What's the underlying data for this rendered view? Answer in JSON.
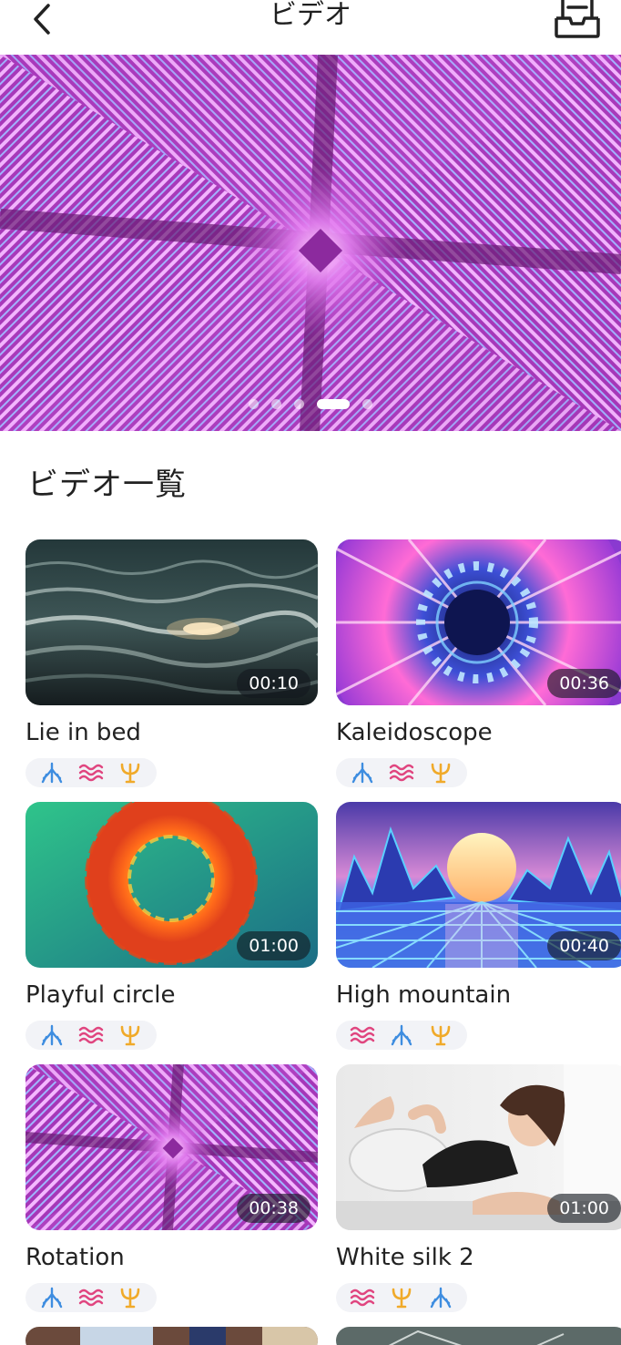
{
  "header": {
    "title": "ビデオ"
  },
  "carousel": {
    "slide_count": 5,
    "active_index": 3
  },
  "section": {
    "title": "ビデオ一覧"
  },
  "colors": {
    "tag_blue": "#3e8de0",
    "tag_pink": "#e0457f",
    "tag_gold": "#f0aa2a",
    "tag_bg": "#f2f3f7"
  },
  "videos": [
    {
      "name": "Lie in bed",
      "duration": "00:10",
      "tags": [
        "flow-icon",
        "wave-icon",
        "trident-icon"
      ]
    },
    {
      "name": "Kaleidoscope",
      "duration": "00:36",
      "tags": [
        "flow-icon",
        "wave-icon",
        "trident-icon"
      ]
    },
    {
      "name": "Playful circle",
      "duration": "01:00",
      "tags": [
        "flow-icon",
        "wave-icon",
        "trident-icon"
      ]
    },
    {
      "name": "High mountain",
      "duration": "00:40",
      "tags": [
        "wave-icon",
        "flow-icon",
        "trident-icon"
      ]
    },
    {
      "name": "Rotation",
      "duration": "00:38",
      "tags": [
        "flow-icon",
        "wave-icon",
        "trident-icon"
      ]
    },
    {
      "name": "White silk 2",
      "duration": "01:00",
      "tags": [
        "wave-icon",
        "trident-icon",
        "flow-icon"
      ]
    }
  ]
}
